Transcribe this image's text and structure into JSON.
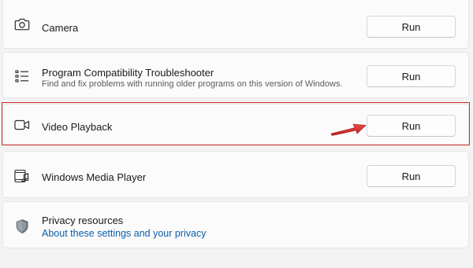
{
  "troubleshooters": [
    {
      "title": "Camera",
      "description": "",
      "icon": "camera-icon",
      "button_label": "Run"
    },
    {
      "title": "Program Compatibility Troubleshooter",
      "description": "Find and fix problems with running older programs on this version of Windows.",
      "icon": "list-icon",
      "button_label": "Run"
    },
    {
      "title": "Video Playback",
      "description": "",
      "icon": "video-icon",
      "button_label": "Run"
    },
    {
      "title": "Windows Media Player",
      "description": "",
      "icon": "media-player-icon",
      "button_label": "Run"
    }
  ],
  "privacy": {
    "title": "Privacy resources",
    "link": "About these settings and your privacy",
    "icon": "shield-icon"
  },
  "annotation": {
    "highlight_color": "#d32a2a",
    "arrow_color": "#d32a2a",
    "highlighted_item": "Video Playback"
  },
  "colors": {
    "link": "#0a5ea8",
    "row_background": "#fbfbfb",
    "page_background": "#f3f3f3"
  }
}
